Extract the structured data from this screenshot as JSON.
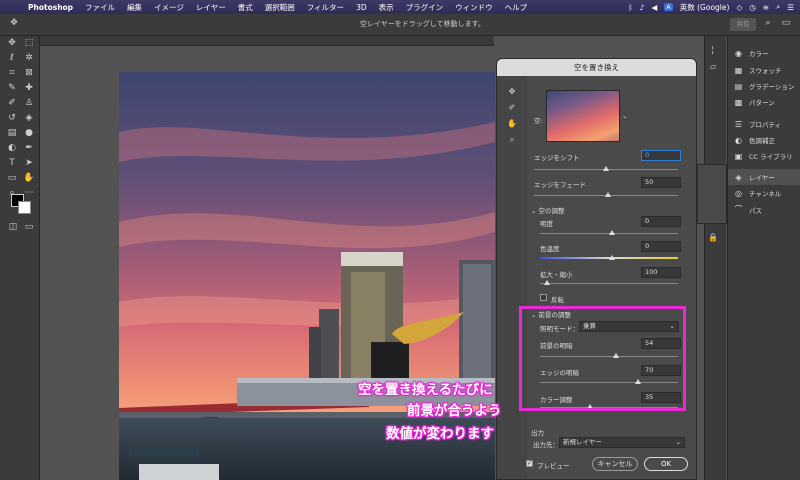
{
  "menubar": {
    "app": "Photoshop",
    "items": [
      "ファイル",
      "編集",
      "イメージ",
      "レイヤー",
      "書式",
      "選択範囲",
      "フィルター",
      "3D",
      "表示",
      "プラグイン",
      "ウィンドウ",
      "ヘルプ"
    ],
    "input_method": "英数 (Google)"
  },
  "options_bar": {
    "hint": "空レイヤーをドラッグして移動します。",
    "share": "共有"
  },
  "dialog": {
    "title": "空を置き換え",
    "sky_label": "空:",
    "shift_edge_label": "エッジをシフト",
    "shift_edge_value": "0",
    "fade_edge_label": "エッジをフェード",
    "fade_edge_value": "50",
    "sky_adjust_section": "空の調整",
    "brightness_label": "明度",
    "brightness_value": "0",
    "temperature_label": "色温度",
    "temperature_value": "0",
    "scale_label": "拡大・縮小",
    "scale_value": "100",
    "flip_label": "反転",
    "fg_section": "前景の調整",
    "light_mode_label": "照明モード：",
    "light_mode_value": "乗算",
    "fg_light_label": "前景の明暗",
    "fg_light_value": "54",
    "edge_light_label": "エッジの明暗",
    "edge_light_value": "70",
    "color_adjust_label": "カラー調整",
    "color_adjust_value": "35",
    "output_section": "出力",
    "output_to_label": "出力先：",
    "output_to_value": "新規レイヤー",
    "preview_label": "プレビュー",
    "cancel": "キャンセル",
    "ok": "OK"
  },
  "callout": {
    "line1": "空を置き換えるたびに",
    "line2": "前景が合うよう",
    "line3": "数値が変わります"
  },
  "panels": {
    "items": [
      "カラー",
      "スウォッチ",
      "グラデーション",
      "パターン",
      "プロパティ",
      "色調補正",
      "CC ライブラリ",
      "レイヤー",
      "チャンネル",
      "パス"
    ],
    "active_index": 7
  },
  "colors": {
    "highlight": "#e82ad6",
    "accent": "#2f7fd6"
  }
}
